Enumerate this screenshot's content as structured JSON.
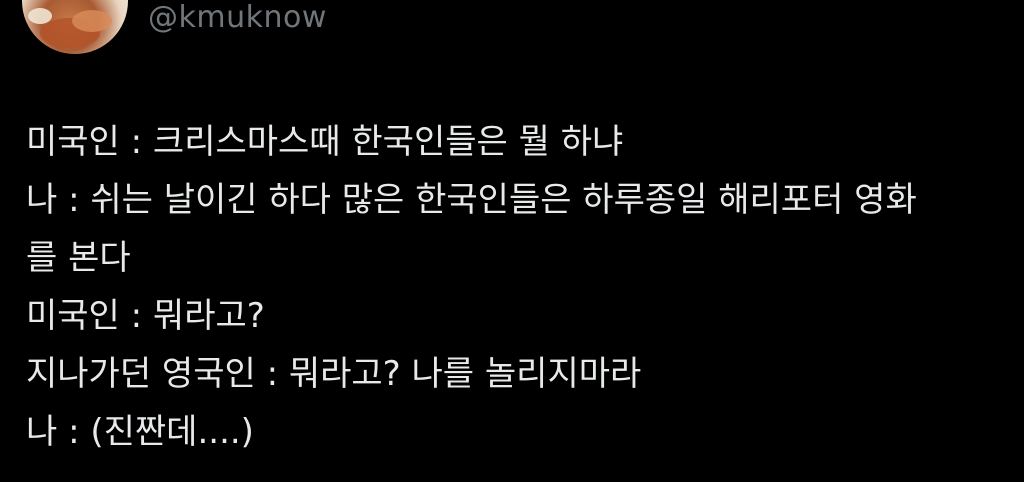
{
  "author": {
    "handle": "@kmuknow",
    "avatar": "profile-avatar-food-photo"
  },
  "tweet": {
    "lines": [
      "미국인 : 크리스마스때 한국인들은 뭘 하냐",
      "나 : 쉬는 날이긴 하다 많은 한국인들은 하루종일 해리포터 영화",
      "를 본다",
      "미국인 : 뭐라고?",
      "지나가던 영국인 : 뭐라고? 나를 놀리지마라",
      "나 : (진짠데....)"
    ]
  },
  "colors": {
    "background": "#000000",
    "text": "#e7e9ea",
    "secondary_text": "#71767b"
  }
}
